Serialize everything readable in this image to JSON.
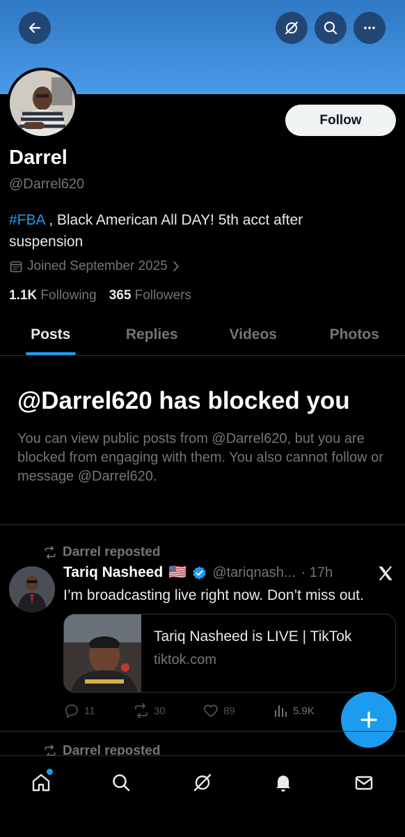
{
  "header": {
    "back_icon": "arrow-left-icon",
    "grok_icon": "grok-icon",
    "search_icon": "search-icon",
    "more_icon": "more-horizontal-icon"
  },
  "profile": {
    "follow_label": "Follow",
    "name": "Darrel",
    "handle": "@Darrel620",
    "bio_tag": "#FBA",
    "bio_rest": " , Black American All DAY! 5th acct after suspension",
    "joined": "Joined September 2025",
    "following_count": "1.1K",
    "following_label": "Following",
    "followers_count": "365",
    "followers_label": "Followers"
  },
  "tabs": [
    {
      "label": "Posts",
      "active": true
    },
    {
      "label": "Replies"
    },
    {
      "label": "Videos"
    },
    {
      "label": "Photos"
    }
  ],
  "blocked": {
    "title": "@Darrel620 has blocked you",
    "text": "You can view public posts from @Darrel620, but you are blocked from engaging with them. You also cannot follow or message @Darrel620."
  },
  "post": {
    "repost_label": "Darrel reposted",
    "author_name": "Tariq Nasheed",
    "flag": "🇺🇸",
    "author_handle": "@tariqnash...",
    "time": "· 17h",
    "text": "I’m broadcasting live right now. Don’t miss out.",
    "card_title": "Tariq Nasheed is LIVE | TikTok",
    "card_domain": "tiktok.com",
    "replies": "11",
    "reposts": "30",
    "likes": "89",
    "views": "5.9K"
  },
  "next_post": {
    "repost_label": "Darrel reposted"
  },
  "colors": {
    "accent": "#1d9bf0",
    "banner": "#4a9be8",
    "muted": "#71767b"
  }
}
